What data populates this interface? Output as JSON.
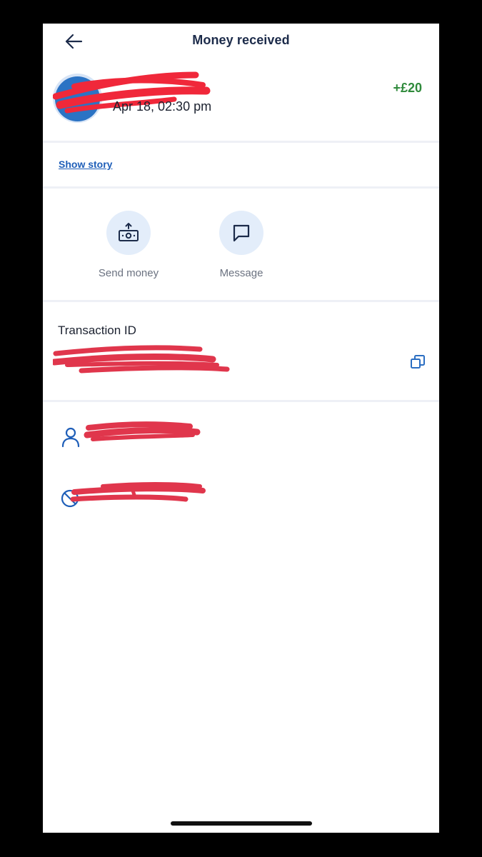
{
  "header": {
    "title": "Money received",
    "back_icon": "arrow-left-icon"
  },
  "transaction": {
    "date": "Apr 18, 02:30 pm",
    "amount": "+£20",
    "show_story_label": "Show story",
    "id_label": "Transaction ID"
  },
  "actions": [
    {
      "label": "Send money",
      "icon": "send-money-icon"
    },
    {
      "label": "Message",
      "icon": "message-icon"
    }
  ],
  "rows": [
    {
      "icon": "person-icon"
    },
    {
      "icon": "block-icon"
    }
  ],
  "colors": {
    "accent": "#1e5eb8",
    "amount_positive": "#2f8a3b",
    "action_bg": "#e3edfa",
    "redaction": "#e8334a",
    "avatar": "#2b73c4"
  }
}
